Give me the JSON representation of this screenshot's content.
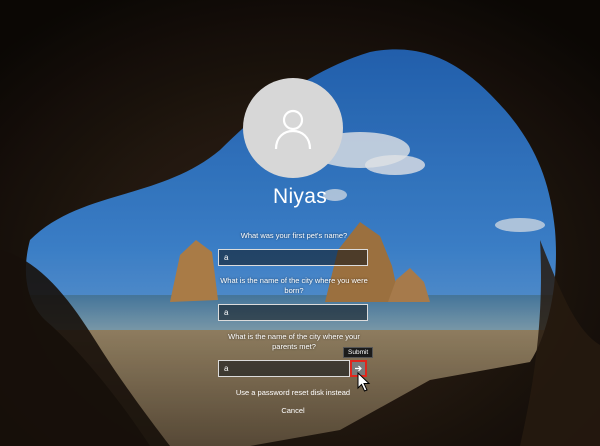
{
  "user": {
    "name": "Niyas",
    "avatar_icon": "user-silhouette-icon"
  },
  "security_questions": [
    {
      "question": "What was your first pet's name?",
      "answer": "a"
    },
    {
      "question": "What is the name of the city where you were born?",
      "answer": "a"
    },
    {
      "question": "What is the name of the city where your parents met?",
      "answer": "a"
    }
  ],
  "submit": {
    "tooltip": "Submit",
    "icon": "arrow-right-icon",
    "highlight_color": "#e0261c"
  },
  "links": {
    "reset_disk": "Use a password reset disk instead",
    "cancel": "Cancel"
  }
}
